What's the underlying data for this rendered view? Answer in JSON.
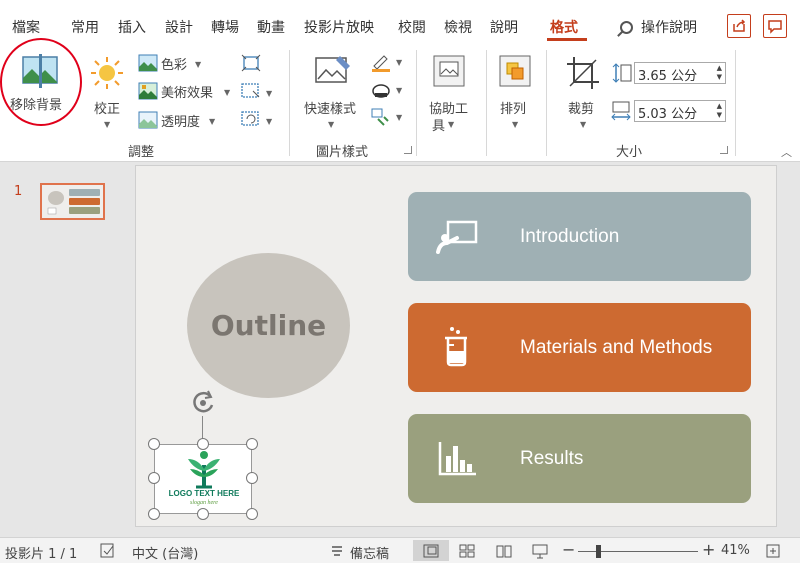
{
  "tabs": [
    "檔案",
    "常用",
    "插入",
    "設計",
    "轉場",
    "動畫",
    "投影片放映",
    "校閱",
    "檢視",
    "說明",
    "格式"
  ],
  "active_tab": "格式",
  "tell_me": "操作說明",
  "ribbon": {
    "remove_bg": "移除背景",
    "corrections": "校正",
    "color": "色彩",
    "artistic": "美術效果",
    "transparency": "透明度",
    "adjust_group": "調整",
    "quick_styles": "快速樣式",
    "picture_styles_group": "圖片樣式",
    "alt_text_line1": "協助工",
    "alt_text_line2": "具",
    "arrange": "排列",
    "crop": "裁剪",
    "height": "3.65 公分",
    "width": "5.03 公分",
    "size_group": "大小"
  },
  "thumbnail": {
    "number": "1"
  },
  "slide": {
    "outline": "Outline",
    "cards": [
      {
        "label": "Introduction",
        "color": "#9fb0b4",
        "icon": "presentation-icon"
      },
      {
        "label": "Materials and Methods",
        "color": "#cd6a31",
        "icon": "beaker-icon"
      },
      {
        "label": "Results",
        "color": "#9aa07e",
        "icon": "bar-chart-icon"
      }
    ],
    "logo_text": "LOGO TEXT HERE",
    "logo_sub": "slogan here"
  },
  "status": {
    "slide_count": "投影片 1 / 1",
    "language": "中文 (台灣)",
    "notes": "備忘稿",
    "zoom": "41%"
  },
  "colors": {
    "accent": "#c43e1c",
    "red_annotation": "#e0001a"
  }
}
